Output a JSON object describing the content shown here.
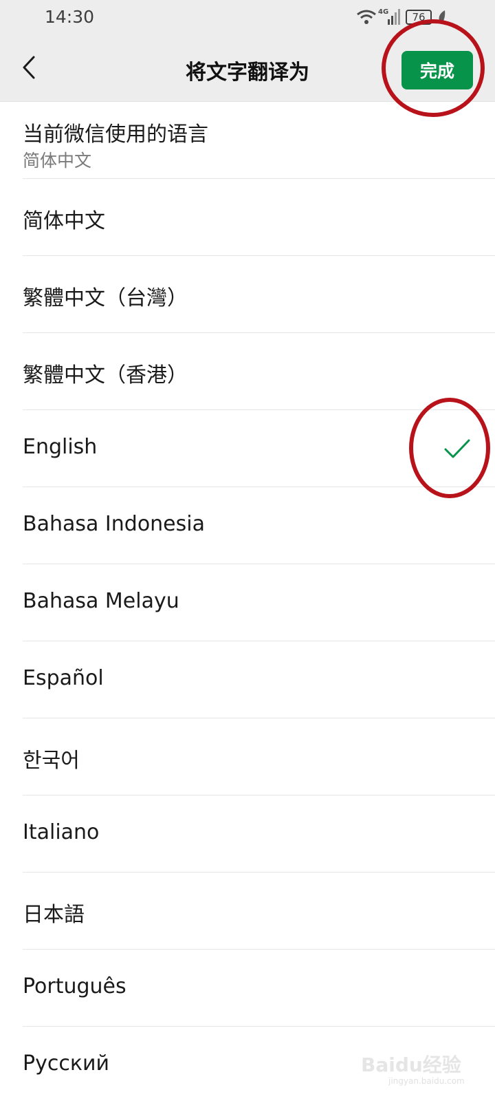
{
  "status_bar": {
    "time": "14:30",
    "network": "4G",
    "battery": "76",
    "icons": [
      "wifi-icon",
      "signal-icon",
      "battery-icon",
      "leaf-icon"
    ]
  },
  "nav": {
    "back_icon": "chevron-left-icon",
    "title": "将文字翻译为",
    "done_label": "完成"
  },
  "current_language": {
    "title": "当前微信使用的语言",
    "value": "简体中文"
  },
  "languages": [
    {
      "label": "简体中文",
      "selected": false
    },
    {
      "label": "繁體中文（台灣）",
      "selected": false
    },
    {
      "label": "繁體中文（香港）",
      "selected": false
    },
    {
      "label": "English",
      "selected": true
    },
    {
      "label": "Bahasa Indonesia",
      "selected": false
    },
    {
      "label": "Bahasa Melayu",
      "selected": false
    },
    {
      "label": "Español",
      "selected": false
    },
    {
      "label": "한국어",
      "selected": false
    },
    {
      "label": "Italiano",
      "selected": false
    },
    {
      "label": "日本語",
      "selected": false
    },
    {
      "label": "Português",
      "selected": false
    },
    {
      "label": "Русский",
      "selected": false
    }
  ],
  "colors": {
    "accent": "#07934a",
    "highlight_ring": "#b8121b",
    "header_bg": "#ededed"
  },
  "watermark": {
    "brand": "Baidu经验",
    "url": "jingyan.baidu.com"
  }
}
